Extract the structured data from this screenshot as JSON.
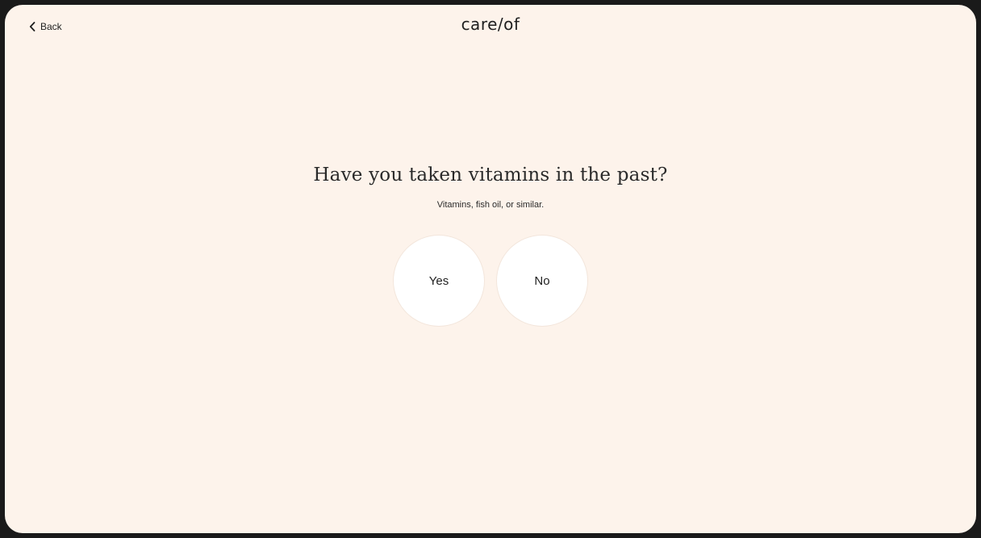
{
  "header": {
    "back_label": "Back",
    "back_icon": "chevron-left-icon",
    "logo_text": "care/of"
  },
  "quiz": {
    "question": "Have you taken vitamins in the past?",
    "subtitle": "Vitamins, fish oil, or similar.",
    "options": [
      {
        "label": "Yes"
      },
      {
        "label": "No"
      }
    ]
  },
  "colors": {
    "background": "#fdf3eb",
    "frame": "#1a1a1a",
    "option_fill": "#ffffff",
    "text": "#1f1f1f"
  }
}
